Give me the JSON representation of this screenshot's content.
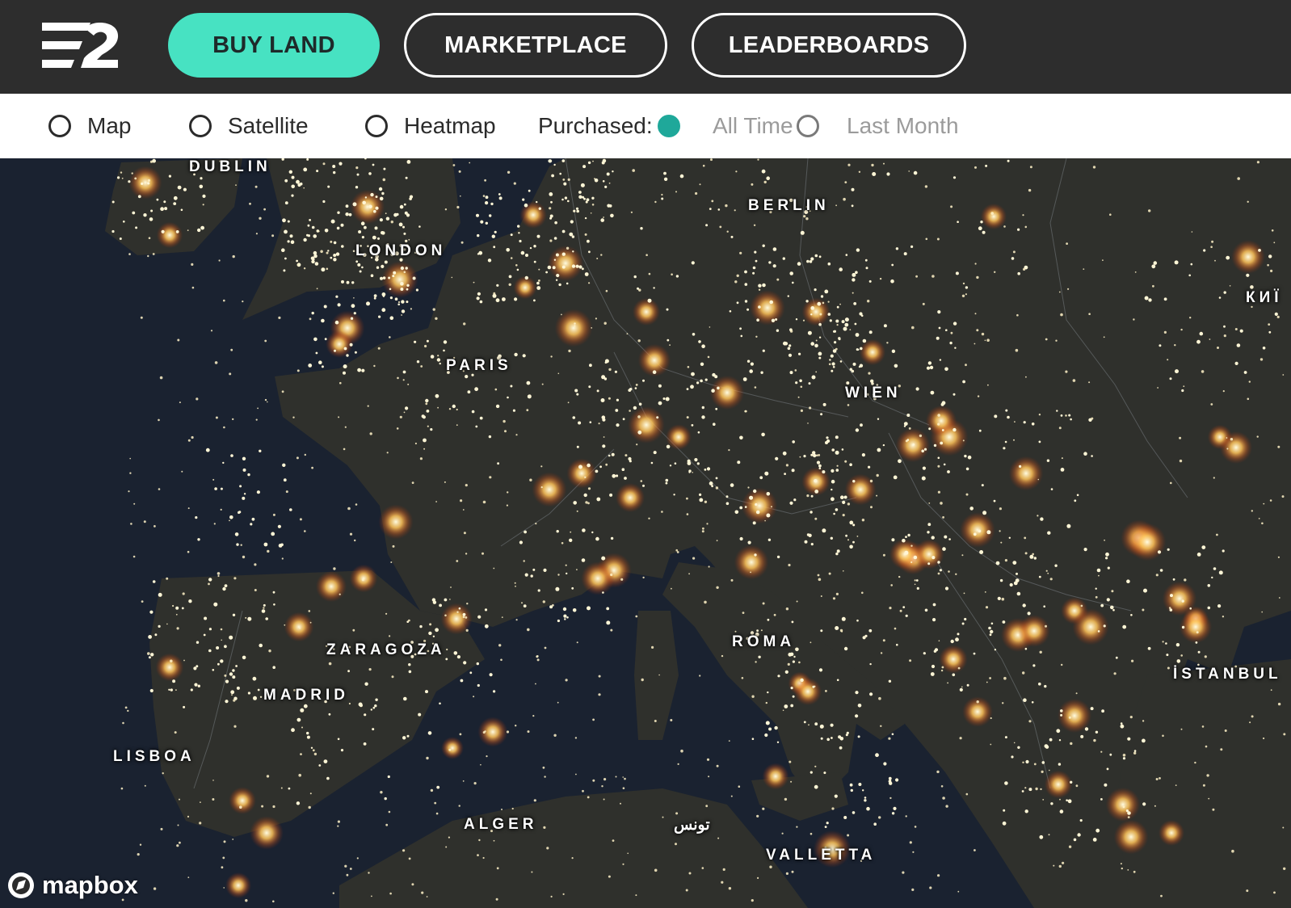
{
  "nav": {
    "buy_land": "BUY LAND",
    "marketplace": "MARKETPLACE",
    "leaderboards": "LEADERBOARDS"
  },
  "toolbar": {
    "map": "Map",
    "satellite": "Satellite",
    "heatmap": "Heatmap",
    "purchased_label": "Purchased:",
    "all_time": "All Time",
    "last_month": "Last Month"
  },
  "cities": {
    "dublin": "DUBLIN",
    "london": "LONDON",
    "berlin": "BERLIN",
    "kyiv": "КИЇ",
    "paris": "PARIS",
    "wien": "WIEN",
    "zaragoza": "ZARAGOZA",
    "madrid": "MADRID",
    "roma": "ROMA",
    "istanbul": "İSTANBUL",
    "lisboa": "LISBOA",
    "alger": "ALGER",
    "tunis": "تونس",
    "valletta": "VALLETTA"
  },
  "attribution": "mapbox",
  "colors": {
    "accent": "#47e2c2",
    "nav_bg": "#2d2d2d",
    "selected_radio": "#1fa89a"
  }
}
